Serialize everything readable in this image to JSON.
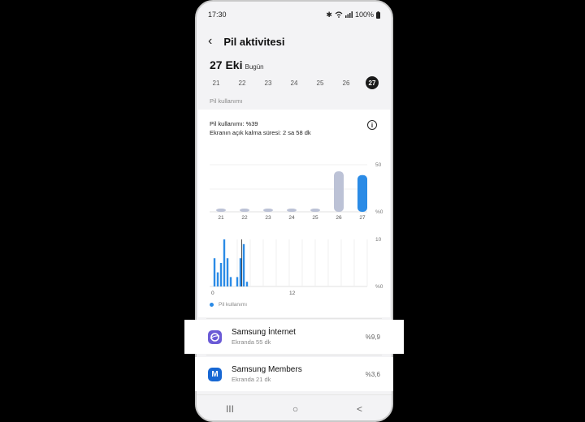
{
  "status": {
    "time": "17:30",
    "battery": "100%"
  },
  "header": {
    "back_icon": "back-arrow-icon",
    "title": "Pil aktivitesi"
  },
  "date": {
    "main": "27 Eki",
    "sub": "Bugün"
  },
  "days": [
    "21",
    "22",
    "23",
    "24",
    "25",
    "26",
    "27"
  ],
  "selected_day": "27",
  "section_label": "Pil kullanımı",
  "summary": {
    "usage": "Pil kullanımı: %39",
    "screen_time": "Ekranın açık kalma süresi: 2 sa 58 dk"
  },
  "chart_data": [
    {
      "type": "bar",
      "categories": [
        "21",
        "22",
        "23",
        "24",
        "25",
        "26",
        "27"
      ],
      "values": [
        2,
        2,
        3,
        2,
        2,
        43,
        39
      ],
      "ytick_labels": [
        "50",
        "%0"
      ],
      "ylim": [
        0,
        50
      ],
      "colors": {
        "past": "#bcc2d6",
        "today": "#2b8be6"
      }
    },
    {
      "type": "bar",
      "x": [
        0.5,
        1.0,
        1.5,
        2.0,
        2.5,
        3.0,
        4.0,
        4.5,
        5.0,
        5.5
      ],
      "values": [
        6,
        3,
        5,
        10,
        6,
        2,
        2,
        6,
        9,
        1
      ],
      "xtick_labels": [
        "0",
        "12"
      ],
      "ytick_labels": [
        "10",
        "%0"
      ],
      "ylim": [
        0,
        10
      ],
      "color": "#2b8be6"
    }
  ],
  "legend": {
    "label": "Pil kullanımı",
    "color": "#2b8be6"
  },
  "apps": [
    {
      "name": "Samsung İnternet",
      "sub": "Ekranda 55 dk",
      "pct": "%9,9",
      "icon": "samsung-internet-icon",
      "color": "#6b5bd6"
    },
    {
      "name": "Samsung Members",
      "sub": "Ekranda 21 dk",
      "pct": "%3,6",
      "icon": "samsung-members-icon",
      "color": "#1767d3",
      "letter": "M"
    }
  ],
  "nav": {
    "recents": "III",
    "home": "○",
    "back": "<"
  }
}
